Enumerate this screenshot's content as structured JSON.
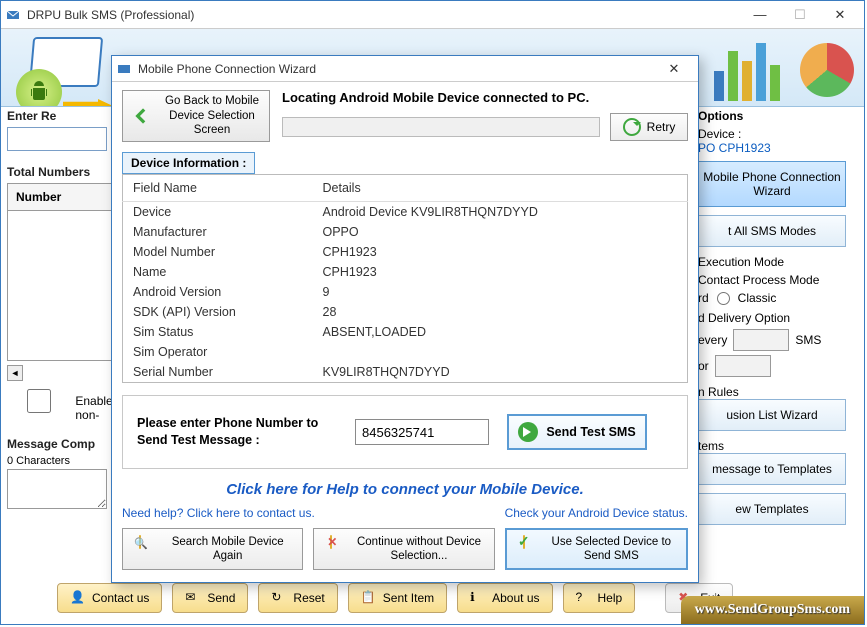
{
  "main": {
    "title": "DRPU Bulk SMS (Professional)"
  },
  "bg": {
    "enterRecip": "Enter Re",
    "totalNumbers": "Total Numbers",
    "numberCol": "Number",
    "enableNon": "Enable non-",
    "msgComp": "Message Comp",
    "charCount": "0 Characters",
    "optionsTitle": "Options",
    "deviceLabel": "Device :",
    "deviceValue": "PO CPH1923",
    "wizardBtn": "Mobile Phone Connection  Wizard",
    "allSms": "t All SMS Modes",
    "execMode": "Execution Mode",
    "contactProc": "Contact Process Mode",
    "radioRd": "rd",
    "radioClassic": "Classic",
    "delivOpt": "d Delivery Option",
    "every": "every",
    "sms": "SMS",
    "or": "or",
    "rules": "n Rules",
    "exclWizard": "usion List Wizard",
    "items": "tems",
    "msgTempl": "message to Templates",
    "viewTempl": "ew Templates"
  },
  "bottomBar": {
    "contact": "Contact us",
    "send": "Send",
    "reset": "Reset",
    "sentItem": "Sent Item",
    "about": "About us",
    "help": "Help",
    "exit": "Exit"
  },
  "watermark": "www.SendGroupSms.com",
  "modal": {
    "title": "Mobile Phone Connection Wizard",
    "goBack": "Go Back to Mobile Device Selection Screen",
    "locating": "Locating Android Mobile Device connected to PC.",
    "retry": "Retry",
    "devInfoTitle": "Device Information :",
    "tableHead": {
      "field": "Field Name",
      "details": "Details"
    },
    "rows": [
      {
        "field": "Device",
        "value": "Android Device KV9LIR8THQN7DYYD"
      },
      {
        "field": "Manufacturer",
        "value": "OPPO"
      },
      {
        "field": "Model Number",
        "value": "CPH1923"
      },
      {
        "field": "Name",
        "value": "CPH1923"
      },
      {
        "field": "Android Version",
        "value": "9"
      },
      {
        "field": "SDK (API) Version",
        "value": "28"
      },
      {
        "field": "Sim Status",
        "value": "ABSENT,LOADED"
      },
      {
        "field": "Sim Operator",
        "value": ""
      },
      {
        "field": "Serial Number",
        "value": "KV9LIR8THQN7DYYD"
      }
    ],
    "testLabel": "Please enter Phone Number to Send Test Message :",
    "testValue": "8456325741",
    "sendTest": "Send Test SMS",
    "helpBig": "Click here for Help to connect your Mobile Device.",
    "needHelp": "Need help? Click here to contact us.",
    "checkStatus": "Check your Android Device status.",
    "searchAgain": "Search Mobile Device Again",
    "continueWithout": "Continue without Device Selection...",
    "useSelected": "Use Selected Device to Send SMS"
  }
}
